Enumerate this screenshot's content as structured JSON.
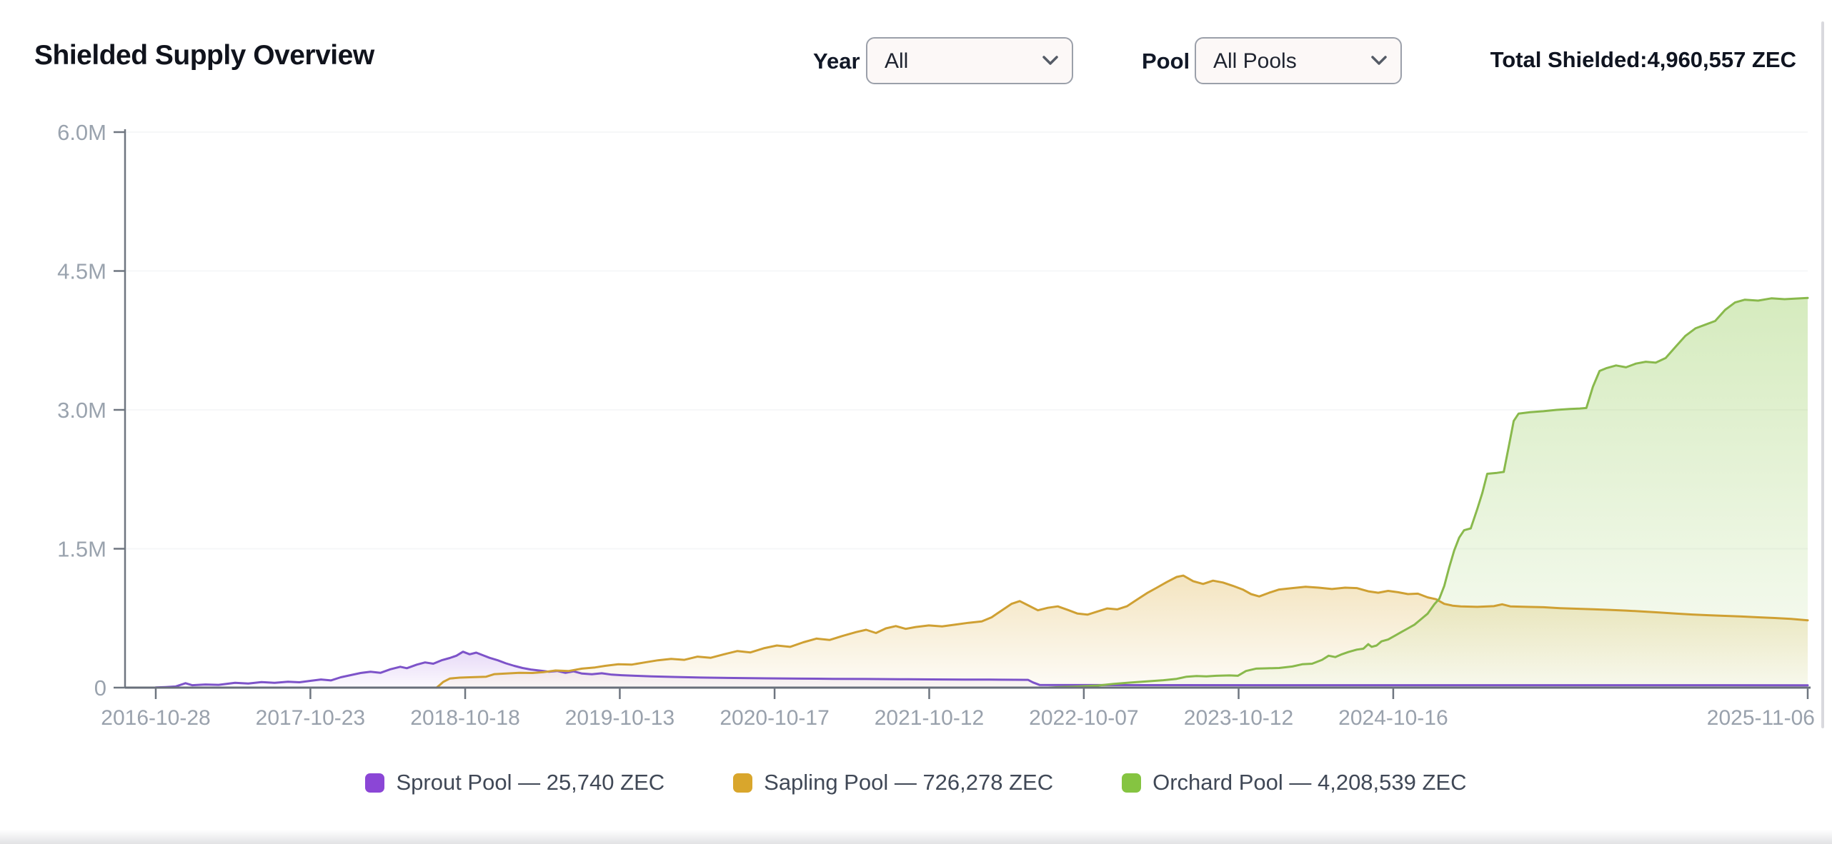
{
  "header": {
    "title": "Shielded Supply Overview",
    "year_label": "Year",
    "year_value": "All",
    "pool_label": "Pool",
    "pool_value": "All Pools",
    "total_label": "Total Shielded:",
    "total_value": "4,960,557 ZEC"
  },
  "chart_data": {
    "type": "area",
    "title": "Shielded Supply Overview",
    "ylim": [
      0,
      6000000
    ],
    "grid": "off",
    "legend_position": "bottom-center",
    "y_ticks": [
      {
        "label": "0",
        "value": 0
      },
      {
        "label": "1.5M",
        "value": 1500000
      },
      {
        "label": "3.0M",
        "value": 3000000
      },
      {
        "label": "4.5M",
        "value": 4500000
      },
      {
        "label": "6.0M",
        "value": 6000000
      }
    ],
    "x_ticks": [
      {
        "label": "2016-10-28",
        "f": 0.0
      },
      {
        "label": "2017-10-23",
        "f": 0.0936
      },
      {
        "label": "2018-10-18",
        "f": 0.1873
      },
      {
        "label": "2019-10-13",
        "f": 0.2809
      },
      {
        "label": "2020-10-17",
        "f": 0.3746
      },
      {
        "label": "2021-10-12",
        "f": 0.4682
      },
      {
        "label": "2022-10-07",
        "f": 0.5618
      },
      {
        "label": "2023-10-12",
        "f": 0.6555
      },
      {
        "label": "2024-10-16",
        "f": 0.7491
      },
      {
        "label": "2025-11-06",
        "f": 1.0
      }
    ],
    "series": [
      {
        "name": "Sprout Pool",
        "current_value": "25,740 ZEC",
        "legend_label": "Sprout Pool — 25,740 ZEC",
        "color": "#8b46d6",
        "line_color": "#7d53c9",
        "points": [
          [
            0.0,
            2000
          ],
          [
            0.006,
            6000
          ],
          [
            0.012,
            12000
          ],
          [
            0.018,
            48000
          ],
          [
            0.022,
            26000
          ],
          [
            0.03,
            34000
          ],
          [
            0.038,
            30000
          ],
          [
            0.048,
            52000
          ],
          [
            0.056,
            44000
          ],
          [
            0.064,
            60000
          ],
          [
            0.072,
            52000
          ],
          [
            0.08,
            64000
          ],
          [
            0.087,
            58000
          ],
          [
            0.094,
            74000
          ],
          [
            0.1,
            88000
          ],
          [
            0.106,
            78000
          ],
          [
            0.112,
            112000
          ],
          [
            0.118,
            135000
          ],
          [
            0.124,
            158000
          ],
          [
            0.13,
            172000
          ],
          [
            0.136,
            160000
          ],
          [
            0.142,
            198000
          ],
          [
            0.148,
            225000
          ],
          [
            0.152,
            210000
          ],
          [
            0.158,
            248000
          ],
          [
            0.163,
            272000
          ],
          [
            0.168,
            258000
          ],
          [
            0.173,
            295000
          ],
          [
            0.178,
            320000
          ],
          [
            0.182,
            345000
          ],
          [
            0.186,
            388000
          ],
          [
            0.19,
            360000
          ],
          [
            0.194,
            378000
          ],
          [
            0.198,
            350000
          ],
          [
            0.202,
            322000
          ],
          [
            0.207,
            295000
          ],
          [
            0.212,
            262000
          ],
          [
            0.217,
            235000
          ],
          [
            0.222,
            212000
          ],
          [
            0.227,
            196000
          ],
          [
            0.232,
            185000
          ],
          [
            0.238,
            172000
          ],
          [
            0.243,
            180000
          ],
          [
            0.248,
            160000
          ],
          [
            0.253,
            176000
          ],
          [
            0.258,
            152000
          ],
          [
            0.264,
            145000
          ],
          [
            0.27,
            155000
          ],
          [
            0.276,
            140000
          ],
          [
            0.282,
            134000
          ],
          [
            0.29,
            128000
          ],
          [
            0.3,
            122000
          ],
          [
            0.315,
            115000
          ],
          [
            0.33,
            109000
          ],
          [
            0.35,
            104000
          ],
          [
            0.37,
            100000
          ],
          [
            0.39,
            97000
          ],
          [
            0.41,
            95000
          ],
          [
            0.43,
            93000
          ],
          [
            0.45,
            91000
          ],
          [
            0.47,
            89000
          ],
          [
            0.49,
            87000
          ],
          [
            0.505,
            86000
          ],
          [
            0.52,
            85000
          ],
          [
            0.528,
            84000
          ],
          [
            0.531,
            56000
          ],
          [
            0.535,
            29000
          ],
          [
            0.55,
            28000
          ],
          [
            0.6,
            27000
          ],
          [
            0.7,
            26500
          ],
          [
            0.8,
            26000
          ],
          [
            0.9,
            25900
          ],
          [
            1.0,
            25740
          ]
        ]
      },
      {
        "name": "Sapling Pool",
        "current_value": "726,278 ZEC",
        "legend_label": "Sapling Pool — 726,278 ZEC",
        "color": "#d9a62c",
        "line_color": "#cfa033",
        "points": [
          [
            0.17,
            0
          ],
          [
            0.172,
            30000
          ],
          [
            0.174,
            62000
          ],
          [
            0.178,
            98000
          ],
          [
            0.184,
            108000
          ],
          [
            0.19,
            112000
          ],
          [
            0.2,
            118000
          ],
          [
            0.205,
            146000
          ],
          [
            0.212,
            152000
          ],
          [
            0.22,
            160000
          ],
          [
            0.228,
            158000
          ],
          [
            0.235,
            168000
          ],
          [
            0.242,
            185000
          ],
          [
            0.25,
            180000
          ],
          [
            0.258,
            205000
          ],
          [
            0.266,
            218000
          ],
          [
            0.272,
            235000
          ],
          [
            0.28,
            252000
          ],
          [
            0.288,
            248000
          ],
          [
            0.296,
            272000
          ],
          [
            0.304,
            295000
          ],
          [
            0.312,
            310000
          ],
          [
            0.32,
            300000
          ],
          [
            0.328,
            335000
          ],
          [
            0.336,
            322000
          ],
          [
            0.344,
            360000
          ],
          [
            0.352,
            395000
          ],
          [
            0.36,
            380000
          ],
          [
            0.368,
            425000
          ],
          [
            0.376,
            455000
          ],
          [
            0.384,
            440000
          ],
          [
            0.392,
            490000
          ],
          [
            0.4,
            530000
          ],
          [
            0.408,
            515000
          ],
          [
            0.416,
            560000
          ],
          [
            0.424,
            600000
          ],
          [
            0.43,
            625000
          ],
          [
            0.436,
            590000
          ],
          [
            0.442,
            640000
          ],
          [
            0.448,
            665000
          ],
          [
            0.454,
            635000
          ],
          [
            0.46,
            655000
          ],
          [
            0.468,
            672000
          ],
          [
            0.476,
            662000
          ],
          [
            0.484,
            680000
          ],
          [
            0.492,
            700000
          ],
          [
            0.5,
            715000
          ],
          [
            0.506,
            760000
          ],
          [
            0.512,
            832000
          ],
          [
            0.518,
            905000
          ],
          [
            0.523,
            935000
          ],
          [
            0.528,
            890000
          ],
          [
            0.534,
            835000
          ],
          [
            0.54,
            862000
          ],
          [
            0.546,
            878000
          ],
          [
            0.552,
            840000
          ],
          [
            0.558,
            800000
          ],
          [
            0.564,
            788000
          ],
          [
            0.57,
            822000
          ],
          [
            0.576,
            855000
          ],
          [
            0.582,
            845000
          ],
          [
            0.588,
            880000
          ],
          [
            0.594,
            950000
          ],
          [
            0.6,
            1020000
          ],
          [
            0.606,
            1080000
          ],
          [
            0.612,
            1140000
          ],
          [
            0.618,
            1195000
          ],
          [
            0.622,
            1210000
          ],
          [
            0.628,
            1150000
          ],
          [
            0.634,
            1120000
          ],
          [
            0.64,
            1155000
          ],
          [
            0.646,
            1135000
          ],
          [
            0.652,
            1100000
          ],
          [
            0.658,
            1060000
          ],
          [
            0.663,
            1010000
          ],
          [
            0.668,
            985000
          ],
          [
            0.674,
            1025000
          ],
          [
            0.68,
            1060000
          ],
          [
            0.688,
            1075000
          ],
          [
            0.696,
            1090000
          ],
          [
            0.704,
            1080000
          ],
          [
            0.712,
            1065000
          ],
          [
            0.72,
            1080000
          ],
          [
            0.727,
            1075000
          ],
          [
            0.734,
            1040000
          ],
          [
            0.74,
            1025000
          ],
          [
            0.746,
            1045000
          ],
          [
            0.752,
            1030000
          ],
          [
            0.758,
            1010000
          ],
          [
            0.764,
            1015000
          ],
          [
            0.77,
            975000
          ],
          [
            0.775,
            955000
          ],
          [
            0.78,
            905000
          ],
          [
            0.785,
            885000
          ],
          [
            0.79,
            878000
          ],
          [
            0.8,
            872000
          ],
          [
            0.81,
            880000
          ],
          [
            0.815,
            900000
          ],
          [
            0.82,
            878000
          ],
          [
            0.83,
            872000
          ],
          [
            0.84,
            868000
          ],
          [
            0.85,
            858000
          ],
          [
            0.86,
            852000
          ],
          [
            0.87,
            846000
          ],
          [
            0.88,
            840000
          ],
          [
            0.89,
            832000
          ],
          [
            0.9,
            822000
          ],
          [
            0.91,
            812000
          ],
          [
            0.92,
            800000
          ],
          [
            0.93,
            790000
          ],
          [
            0.94,
            782000
          ],
          [
            0.95,
            775000
          ],
          [
            0.96,
            768000
          ],
          [
            0.97,
            760000
          ],
          [
            0.98,
            752000
          ],
          [
            0.99,
            742000
          ],
          [
            1.0,
            726278
          ]
        ]
      },
      {
        "name": "Orchard Pool",
        "current_value": "4,208,539 ZEC",
        "legend_label": "Orchard Pool — 4,208,539 ZEC",
        "color": "#85c441",
        "line_color": "#89b94c",
        "points": [
          [
            0.54,
            0
          ],
          [
            0.545,
            4000
          ],
          [
            0.55,
            8000
          ],
          [
            0.555,
            10000
          ],
          [
            0.56,
            14000
          ],
          [
            0.57,
            22000
          ],
          [
            0.58,
            40000
          ],
          [
            0.59,
            55000
          ],
          [
            0.6,
            68000
          ],
          [
            0.61,
            80000
          ],
          [
            0.618,
            95000
          ],
          [
            0.624,
            118000
          ],
          [
            0.63,
            125000
          ],
          [
            0.636,
            122000
          ],
          [
            0.642,
            128000
          ],
          [
            0.65,
            132000
          ],
          [
            0.655,
            128000
          ],
          [
            0.66,
            180000
          ],
          [
            0.666,
            205000
          ],
          [
            0.672,
            208000
          ],
          [
            0.68,
            212000
          ],
          [
            0.688,
            228000
          ],
          [
            0.694,
            252000
          ],
          [
            0.7,
            258000
          ],
          [
            0.706,
            300000
          ],
          [
            0.71,
            345000
          ],
          [
            0.714,
            330000
          ],
          [
            0.718,
            360000
          ],
          [
            0.722,
            385000
          ],
          [
            0.727,
            410000
          ],
          [
            0.731,
            420000
          ],
          [
            0.734,
            470000
          ],
          [
            0.736,
            440000
          ],
          [
            0.739,
            455000
          ],
          [
            0.742,
            500000
          ],
          [
            0.746,
            520000
          ],
          [
            0.75,
            560000
          ],
          [
            0.754,
            600000
          ],
          [
            0.758,
            640000
          ],
          [
            0.762,
            680000
          ],
          [
            0.766,
            740000
          ],
          [
            0.77,
            800000
          ],
          [
            0.774,
            900000
          ],
          [
            0.777,
            960000
          ],
          [
            0.78,
            1100000
          ],
          [
            0.783,
            1300000
          ],
          [
            0.786,
            1480000
          ],
          [
            0.789,
            1620000
          ],
          [
            0.792,
            1700000
          ],
          [
            0.796,
            1720000
          ],
          [
            0.8,
            1930000
          ],
          [
            0.803,
            2100000
          ],
          [
            0.806,
            2310000
          ],
          [
            0.812,
            2320000
          ],
          [
            0.816,
            2330000
          ],
          [
            0.819,
            2600000
          ],
          [
            0.822,
            2880000
          ],
          [
            0.825,
            2960000
          ],
          [
            0.832,
            2975000
          ],
          [
            0.84,
            2985000
          ],
          [
            0.848,
            3000000
          ],
          [
            0.856,
            3010000
          ],
          [
            0.862,
            3015000
          ],
          [
            0.866,
            3020000
          ],
          [
            0.87,
            3250000
          ],
          [
            0.874,
            3420000
          ],
          [
            0.878,
            3450000
          ],
          [
            0.884,
            3480000
          ],
          [
            0.89,
            3460000
          ],
          [
            0.896,
            3500000
          ],
          [
            0.902,
            3520000
          ],
          [
            0.908,
            3510000
          ],
          [
            0.914,
            3560000
          ],
          [
            0.92,
            3680000
          ],
          [
            0.926,
            3800000
          ],
          [
            0.932,
            3880000
          ],
          [
            0.938,
            3920000
          ],
          [
            0.944,
            3960000
          ],
          [
            0.95,
            4080000
          ],
          [
            0.956,
            4160000
          ],
          [
            0.962,
            4190000
          ],
          [
            0.97,
            4180000
          ],
          [
            0.978,
            4205000
          ],
          [
            0.986,
            4195000
          ],
          [
            1.0,
            4208539
          ]
        ]
      }
    ]
  }
}
